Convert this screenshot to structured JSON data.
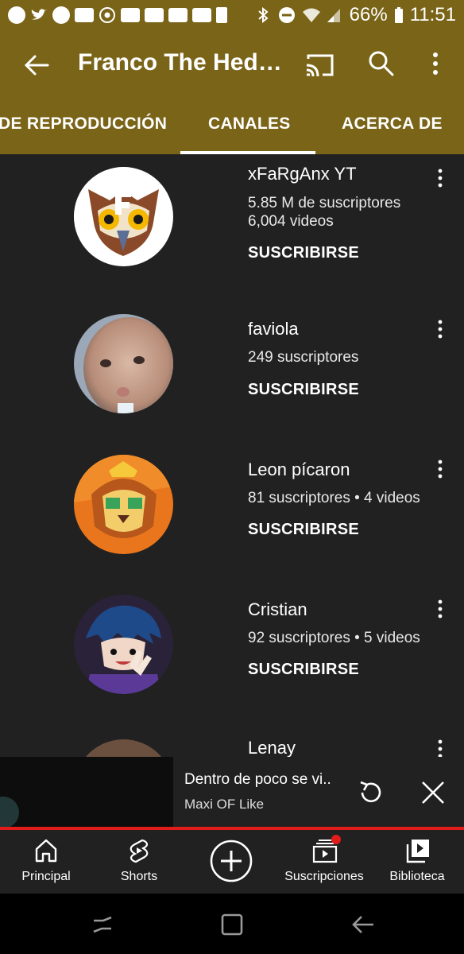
{
  "status_bar": {
    "battery": "66%",
    "time": "11:51",
    "icons": [
      "spotify-icon",
      "twitter-icon",
      "shazam-icon",
      "gallery-icon",
      "chrome-icon",
      "youtube-icon",
      "youtube-icon",
      "youtube-icon",
      "youtube-icon",
      "sd-card-icon",
      "bluetooth-icon",
      "do-not-disturb-icon",
      "wifi-icon",
      "signal-icon"
    ]
  },
  "app_bar": {
    "title": "Franco The Hed…",
    "icons": [
      "back-arrow-icon",
      "cast-icon",
      "search-icon",
      "more-vert-icon"
    ]
  },
  "tabs": [
    {
      "label": "DE REPRODUCCIÓN"
    },
    {
      "label": "CANALES",
      "selected": true
    },
    {
      "label": "ACERCA DE"
    }
  ],
  "channels": [
    {
      "name": "xFaRgAnx YT",
      "meta1": "5.85 M de suscriptores",
      "meta2": "6,004 videos",
      "action": "SUSCRIBIRSE"
    },
    {
      "name": "faviola",
      "meta1": "249 suscriptores",
      "meta2": "",
      "action": "SUSCRIBIRSE"
    },
    {
      "name": "Leon pícaron",
      "meta1": "81 suscriptores • 4 videos",
      "meta2": "",
      "action": "SUSCRIBIRSE"
    },
    {
      "name": "Cristian",
      "meta1": "92 suscriptores • 5 videos",
      "meta2": "",
      "action": "SUSCRIBIRSE"
    },
    {
      "name": "Lenay",
      "meta1": "",
      "meta2": "",
      "action": ""
    }
  ],
  "mini_player": {
    "title": "Dentro de poco se vi..",
    "author": "Maxi OF Like"
  },
  "bottom_nav": [
    {
      "label": "Principal",
      "icon": "home-icon"
    },
    {
      "label": "Shorts",
      "icon": "shorts-icon"
    },
    {
      "label": "",
      "icon": "create-icon"
    },
    {
      "label": "Suscripciones",
      "icon": "subscriptions-icon",
      "badge": true
    },
    {
      "label": "Biblioteca",
      "icon": "library-icon"
    }
  ],
  "colors": {
    "header": "#7a6418",
    "background": "#212121",
    "accent_red": "#e21b1b"
  }
}
